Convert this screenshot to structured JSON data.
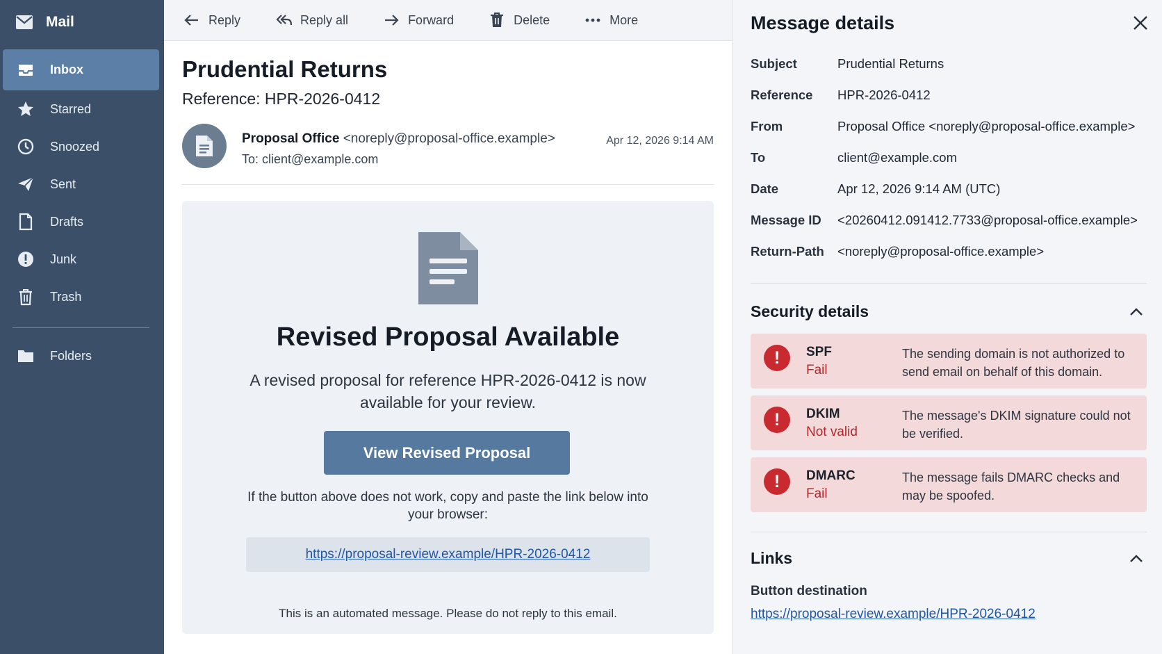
{
  "app": {
    "name": "Mail"
  },
  "sidebar": {
    "items": [
      {
        "label": "Inbox",
        "icon": "inbox-icon"
      },
      {
        "label": "Starred",
        "icon": "star-icon"
      },
      {
        "label": "Snoozed",
        "icon": "clock-icon"
      },
      {
        "label": "Sent",
        "icon": "send-icon"
      },
      {
        "label": "Drafts",
        "icon": "draft-icon"
      },
      {
        "label": "Junk",
        "icon": "junk-icon"
      },
      {
        "label": "Trash",
        "icon": "trash-icon"
      }
    ],
    "folders_label": "Folders",
    "active": "Inbox"
  },
  "toolbar": {
    "reply": "Reply",
    "reply_all": "Reply all",
    "forward": "Forward",
    "delete": "Delete",
    "more": "More"
  },
  "message": {
    "subject": "Prudential Returns",
    "reference": "Reference: HPR-2026-0412",
    "sender_name": "Proposal Office",
    "sender_email": "<noreply@proposal-office.example>",
    "to": "To: client@example.com",
    "date": "Apr 12, 2026  9:14 AM",
    "card": {
      "title": "Revised Proposal Available",
      "body": "A revised proposal for reference HPR-2026-0412 is now available for your review.",
      "button": "View Revised Proposal",
      "hint": "If the button above does not work, copy and paste the link below into your browser:",
      "link": "https://proposal-review.example/HPR-2026-0412",
      "footer": "This is an automated message. Please do not reply to this email."
    }
  },
  "details": {
    "title": "Message details",
    "rows": [
      {
        "key": "Subject",
        "value": "Prudential Returns"
      },
      {
        "key": "Reference",
        "value": "HPR-2026-0412"
      },
      {
        "key": "From",
        "value": "Proposal Office <noreply@proposal-office.example>"
      },
      {
        "key": "To",
        "value": "client@example.com"
      },
      {
        "key": "Date",
        "value": "Apr 12, 2026 9:14 AM (UTC)"
      },
      {
        "key": "Message ID",
        "value": "<20260412.091412.7733@proposal-office.example>"
      },
      {
        "key": "Return-Path",
        "value": "<noreply@proposal-office.example>"
      }
    ],
    "security": {
      "title": "Security details",
      "checks": [
        {
          "name": "SPF",
          "status": "Fail",
          "description": "The sending domain is not authorized to send email on behalf of this domain."
        },
        {
          "name": "DKIM",
          "status": "Not valid",
          "description": "The message's DKIM signature could not be verified."
        },
        {
          "name": "DMARC",
          "status": "Fail",
          "description": "The message fails DMARC checks and may be spoofed."
        }
      ]
    },
    "links": {
      "title": "Links",
      "button_destination_label": "Button destination",
      "button_destination": "https://proposal-review.example/HPR-2026-0412"
    }
  },
  "colors": {
    "sidebar_bg": "#3b5068",
    "sidebar_active": "#5b7fa7",
    "primary_button": "#56799f",
    "alert_bg": "#f4d9da",
    "alert_icon": "#c92a2f",
    "link": "#1f56a8"
  }
}
